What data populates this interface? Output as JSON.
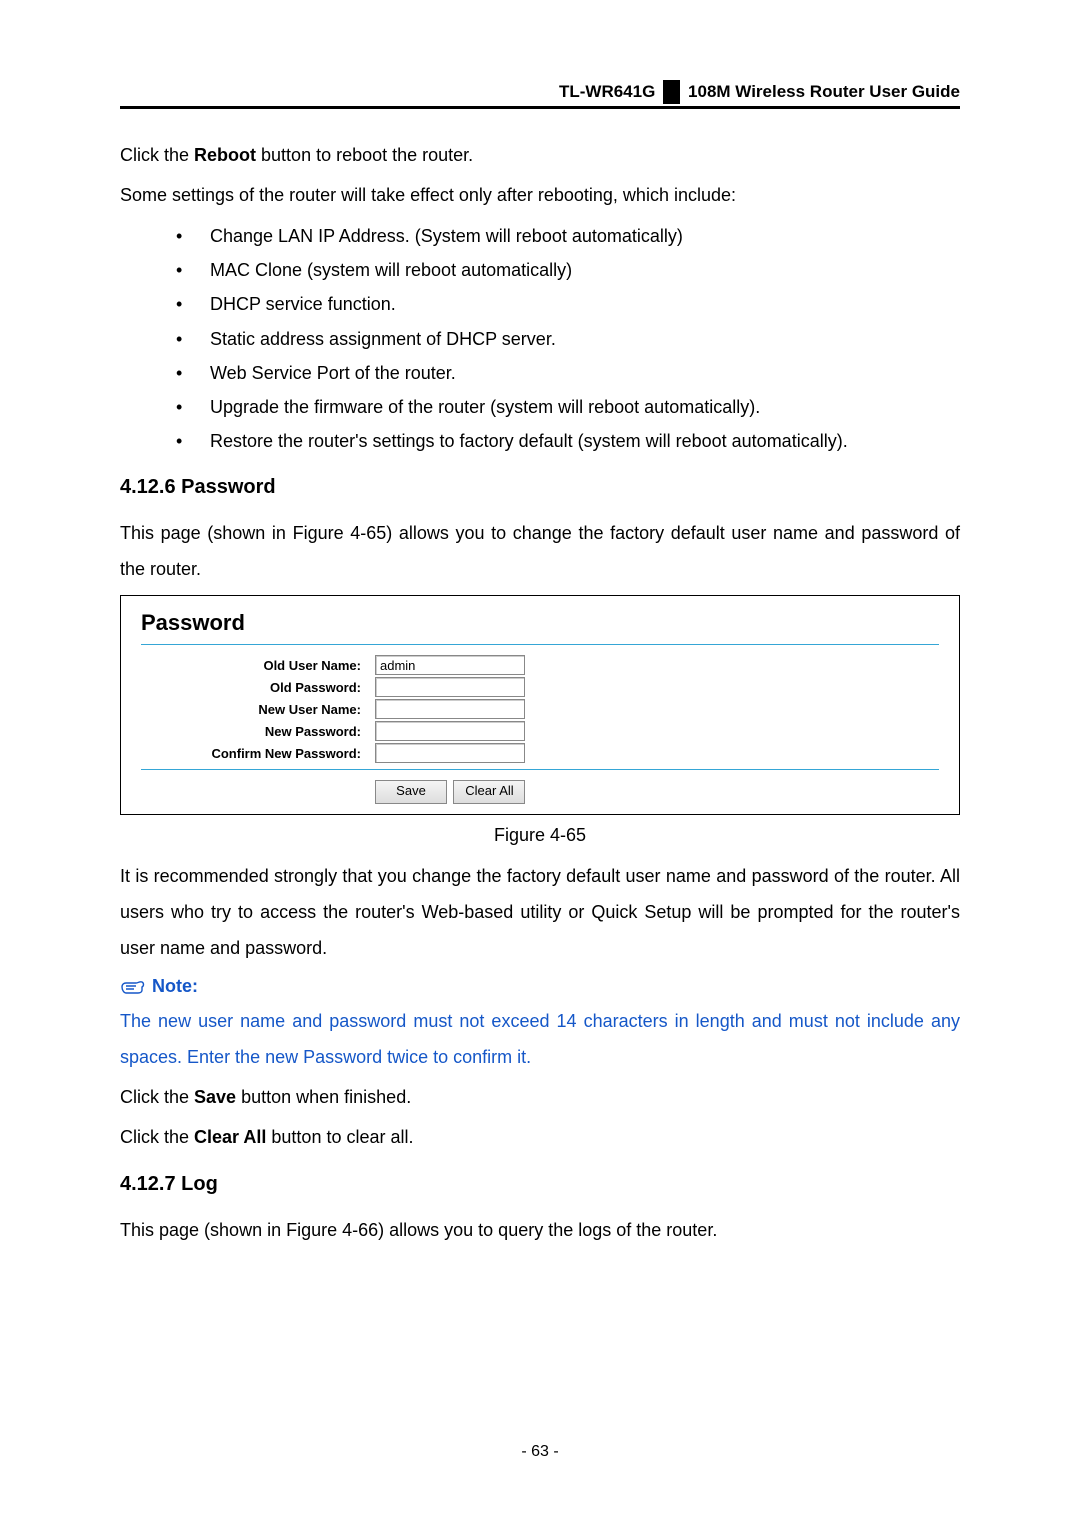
{
  "header": {
    "model": "TL-WR641G",
    "guide": "108M  Wireless  Router  User  Guide"
  },
  "intro": {
    "p1_pre": "Click the ",
    "p1_bold": "Reboot",
    "p1_post": " button to reboot the router.",
    "p2": "Some settings of the router will take effect only after rebooting, which include:"
  },
  "bullets": [
    "Change LAN IP Address. (System will reboot automatically)",
    "MAC Clone (system will reboot automatically)",
    "DHCP service function.",
    "Static address assignment of DHCP server.",
    "Web Service Port of the router.",
    "Upgrade the firmware of the router (system will reboot automatically).",
    "Restore the router's settings to factory default (system will reboot automatically)."
  ],
  "section_password": {
    "heading": "4.12.6 Password",
    "desc": "This  page  (shown  in  Figure  4-65)  allows  you  to  change  the  factory  default  user  name  and password of the router."
  },
  "password_panel": {
    "title": "Password",
    "labels": {
      "old_user": "Old User Name:",
      "old_pass": "Old Password:",
      "new_user": "New User Name:",
      "new_pass": "New Password:",
      "confirm": "Confirm New Password:"
    },
    "values": {
      "old_user": "admin",
      "old_pass": "",
      "new_user": "",
      "new_pass": "",
      "confirm": ""
    },
    "buttons": {
      "save": "Save",
      "clear": "Clear All"
    }
  },
  "figure_caption": "Figure 4-65",
  "recommend": "It is recommended strongly that you change the factory default user name and password of the router.  All  users  who  try  to  access  the  router's  Web-based  utility  or  Quick  Setup  will  be prompted for the router's user name and password.",
  "note": {
    "label": "Note:",
    "text": "The new user name and password must not exceed 14 characters in length and must not include any spaces. Enter the new Password twice to confirm it."
  },
  "after_note": {
    "save_pre": "Click the ",
    "save_bold": "Save",
    "save_post": " button when finished.",
    "clear_pre": "Click the ",
    "clear_bold": "Clear All",
    "clear_post": " button to clear all."
  },
  "section_log": {
    "heading": "4.12.7 Log",
    "desc": "This page (shown in Figure 4-66) allows you to query the logs of the router."
  },
  "page_number": "- 63 -"
}
